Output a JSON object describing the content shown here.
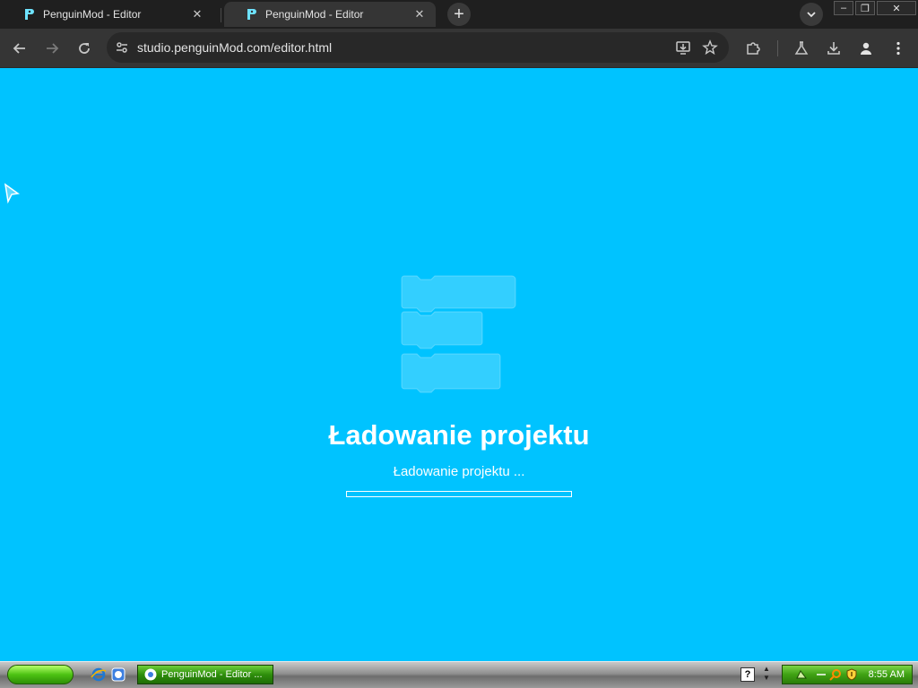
{
  "browser": {
    "tabs": [
      {
        "title": "PenguinMod - Editor",
        "active": false
      },
      {
        "title": "PenguinMod - Editor",
        "active": true
      }
    ],
    "new_tab_label": "+",
    "tab_close_label": "✕",
    "url": "studio.penguinMod.com/editor.html",
    "window_controls": {
      "minimize": "–",
      "restore": "❐",
      "close": "✕"
    }
  },
  "page": {
    "background": "#00c3ff",
    "title": "Ładowanie projektu",
    "subtitle": "Ładowanie projektu ...",
    "progress": 0
  },
  "taskbar": {
    "task_label": "PenguinMod - Editor ...",
    "clock": "8:55 AM",
    "help_label": "?"
  },
  "icons": {
    "penguin": "penguinmod-favicon-icon",
    "back": "arrow-left-icon",
    "forward": "arrow-right-icon",
    "reload": "reload-icon",
    "site_info": "tune-icon",
    "install": "install-app-icon",
    "bookmark": "star-icon",
    "extensions": "puzzle-icon",
    "labs": "flask-icon",
    "downloads": "download-icon",
    "profile": "person-icon",
    "menu": "kebab-menu-icon"
  },
  "colors": {
    "chrome_dark": "#1f1f1f",
    "toolbar": "#353535",
    "omnibox": "#282828",
    "taskbar_green": "#3fa214"
  }
}
